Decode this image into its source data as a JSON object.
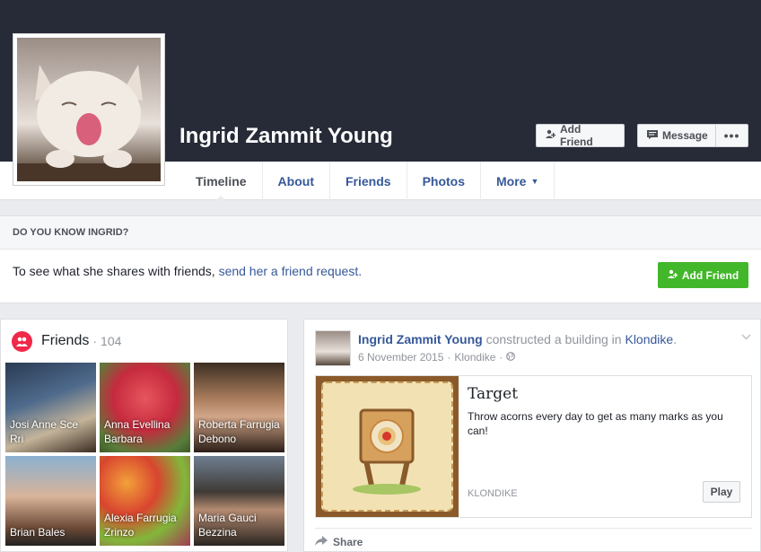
{
  "profile": {
    "name": "Ingrid Zammit Young",
    "add_friend_label": "Add Friend",
    "message_label": "Message",
    "more_dots": "•••"
  },
  "nav": {
    "tabs": [
      {
        "label": "Timeline"
      },
      {
        "label": "About"
      },
      {
        "label": "Friends"
      },
      {
        "label": "Photos"
      },
      {
        "label": "More"
      }
    ],
    "more_caret": "▼"
  },
  "know": {
    "heading": "DO YOU KNOW INGRID?",
    "text": "To see what she shares with friends, ",
    "link": "send her a friend request.",
    "button": "Add Friend"
  },
  "friends": {
    "title": "Friends",
    "separator": "·",
    "count": "104",
    "tiles": [
      {
        "name": "Josi Anne Sce Rri"
      },
      {
        "name": "Anna Evellina Barbara"
      },
      {
        "name": "Roberta Farrugia Debono"
      },
      {
        "name": "Brian Bales"
      },
      {
        "name": "Alexia Farrugia Zrinzo"
      },
      {
        "name": "Maria Gauci Bezzina"
      }
    ]
  },
  "post": {
    "author": "Ingrid Zammit Young",
    "action": "constructed a building in",
    "place": "Klondike",
    "date": "6 November 2015",
    "dot": "·",
    "app": "Klondike",
    "attachment": {
      "title": "Target",
      "description": "Throw acorns every day to get as many marks as you can!",
      "site": "KLONDIKE",
      "play_label": "Play"
    },
    "share_label": "Share"
  },
  "colors": {
    "cover": "#272b38",
    "link": "#365899",
    "green": "#42b72a",
    "friends_badge": "#f02849"
  }
}
